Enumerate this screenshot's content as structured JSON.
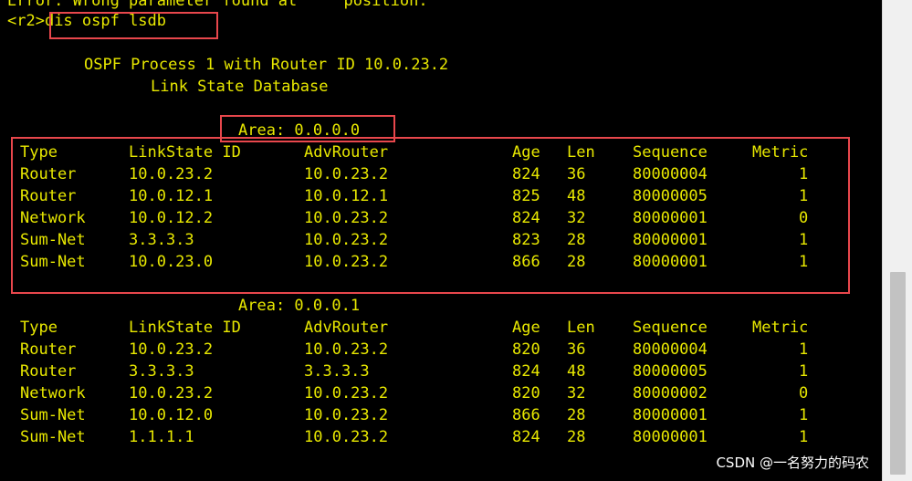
{
  "terminal": {
    "error_line": "Error: Wrong parameter found at '^' position.",
    "prompt": "<r2>",
    "command": "dis ospf lsdb",
    "process_line": "OSPF Process 1 with Router ID 10.0.23.2",
    "database_title": "Link State Database"
  },
  "areas": [
    {
      "label": "Area: 0.0.0.0",
      "headers": [
        "Type",
        "LinkState ID",
        "AdvRouter",
        "Age",
        "Len",
        "Sequence",
        "Metric"
      ],
      "rows": [
        [
          "Router",
          "10.0.23.2",
          "10.0.23.2",
          "824",
          "36",
          "80000004",
          "1"
        ],
        [
          "Router",
          "10.0.12.1",
          "10.0.12.1",
          "825",
          "48",
          "80000005",
          "1"
        ],
        [
          "Network",
          "10.0.12.2",
          "10.0.23.2",
          "824",
          "32",
          "80000001",
          "0"
        ],
        [
          "Sum-Net",
          "3.3.3.3",
          "10.0.23.2",
          "823",
          "28",
          "80000001",
          "1"
        ],
        [
          "Sum-Net",
          "10.0.23.0",
          "10.0.23.2",
          "866",
          "28",
          "80000001",
          "1"
        ]
      ]
    },
    {
      "label": "Area: 0.0.0.1",
      "headers": [
        "Type",
        "LinkState ID",
        "AdvRouter",
        "Age",
        "Len",
        "Sequence",
        "Metric"
      ],
      "rows": [
        [
          "Router",
          "10.0.23.2",
          "10.0.23.2",
          "820",
          "36",
          "80000004",
          "1"
        ],
        [
          "Router",
          "3.3.3.3",
          "3.3.3.3",
          "824",
          "48",
          "80000005",
          "1"
        ],
        [
          "Network",
          "10.0.23.2",
          "10.0.23.2",
          "820",
          "32",
          "80000002",
          "0"
        ],
        [
          "Sum-Net",
          "10.0.12.0",
          "10.0.23.2",
          "866",
          "28",
          "80000001",
          "1"
        ],
        [
          "Sum-Net",
          "1.1.1.1",
          "10.0.23.2",
          "824",
          "28",
          "80000001",
          "1"
        ]
      ]
    }
  ],
  "watermark": "CSDN @一名努力的码农",
  "colors": {
    "background": "#000000",
    "text": "#e8e800",
    "highlight": "#e8474c"
  }
}
